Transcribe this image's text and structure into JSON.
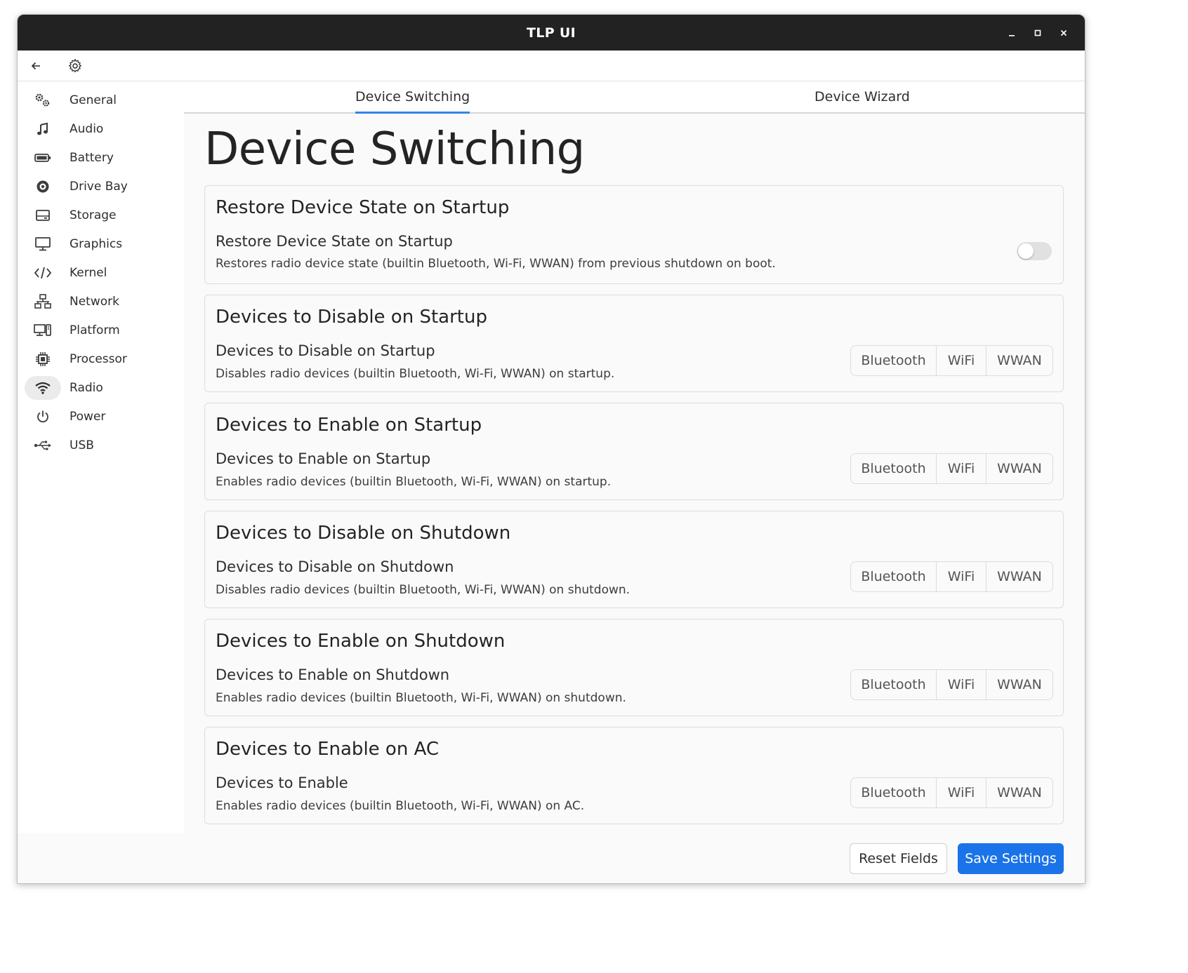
{
  "window": {
    "title": "TLP UI"
  },
  "window_controls": {
    "minimize": "–",
    "maximize": "□",
    "close": "✕"
  },
  "header": {
    "back_icon": "back-arrow-icon",
    "settings_icon": "gear-icon"
  },
  "sidebar": {
    "items": [
      {
        "label": "General",
        "icon": "gears-icon"
      },
      {
        "label": "Audio",
        "icon": "music-note-icon"
      },
      {
        "label": "Battery",
        "icon": "battery-icon"
      },
      {
        "label": "Drive Bay",
        "icon": "disc-icon"
      },
      {
        "label": "Storage",
        "icon": "storage-icon"
      },
      {
        "label": "Graphics",
        "icon": "monitor-icon"
      },
      {
        "label": "Kernel",
        "icon": "code-icon"
      },
      {
        "label": "Network",
        "icon": "network-icon"
      },
      {
        "label": "Platform",
        "icon": "platform-icon"
      },
      {
        "label": "Processor",
        "icon": "cpu-icon"
      },
      {
        "label": "Radio",
        "icon": "wifi-icon"
      },
      {
        "label": "Power",
        "icon": "power-icon"
      },
      {
        "label": "USB",
        "icon": "usb-icon"
      }
    ],
    "active": "Radio"
  },
  "tabs": [
    {
      "label": "Device Switching",
      "active": true
    },
    {
      "label": "Device Wizard",
      "active": false
    }
  ],
  "page": {
    "title": "Device Switching"
  },
  "cards": [
    {
      "title": "Restore Device State on Startup",
      "row_title": "Restore Device State on Startup",
      "row_desc": "Restores radio device state (builtin Bluetooth, Wi-Fi, WWAN) from previous shutdown on boot.",
      "control": "toggle",
      "toggle_on": false
    },
    {
      "title": "Devices to Disable on Startup",
      "row_title": "Devices to Disable on Startup",
      "row_desc": "Disables radio devices (builtin Bluetooth, Wi-Fi, WWAN) on startup.",
      "control": "segmented"
    },
    {
      "title": "Devices to Enable on Startup",
      "row_title": "Devices to Enable on Startup",
      "row_desc": "Enables radio devices (builtin Bluetooth, Wi-Fi, WWAN) on startup.",
      "control": "segmented"
    },
    {
      "title": "Devices to Disable on Shutdown",
      "row_title": "Devices to Disable on Shutdown",
      "row_desc": "Disables radio devices (builtin Bluetooth, Wi-Fi, WWAN) on shutdown.",
      "control": "segmented"
    },
    {
      "title": "Devices to Enable on Shutdown",
      "row_title": "Devices to Enable on Shutdown",
      "row_desc": "Enables radio devices (builtin Bluetooth, Wi-Fi, WWAN) on shutdown.",
      "control": "segmented"
    },
    {
      "title": "Devices to Enable on AC",
      "row_title": "Devices to Enable",
      "row_desc": "Enables radio devices (builtin Bluetooth, Wi-Fi, WWAN) on AC.",
      "control": "segmented"
    }
  ],
  "device_options": [
    "Bluetooth",
    "WiFi",
    "WWAN"
  ],
  "footer": {
    "reset_label": "Reset Fields",
    "save_label": "Save Settings"
  },
  "colors": {
    "accent": "#3584e4",
    "save_button": "#1a73e8",
    "titlebar": "#222222"
  }
}
